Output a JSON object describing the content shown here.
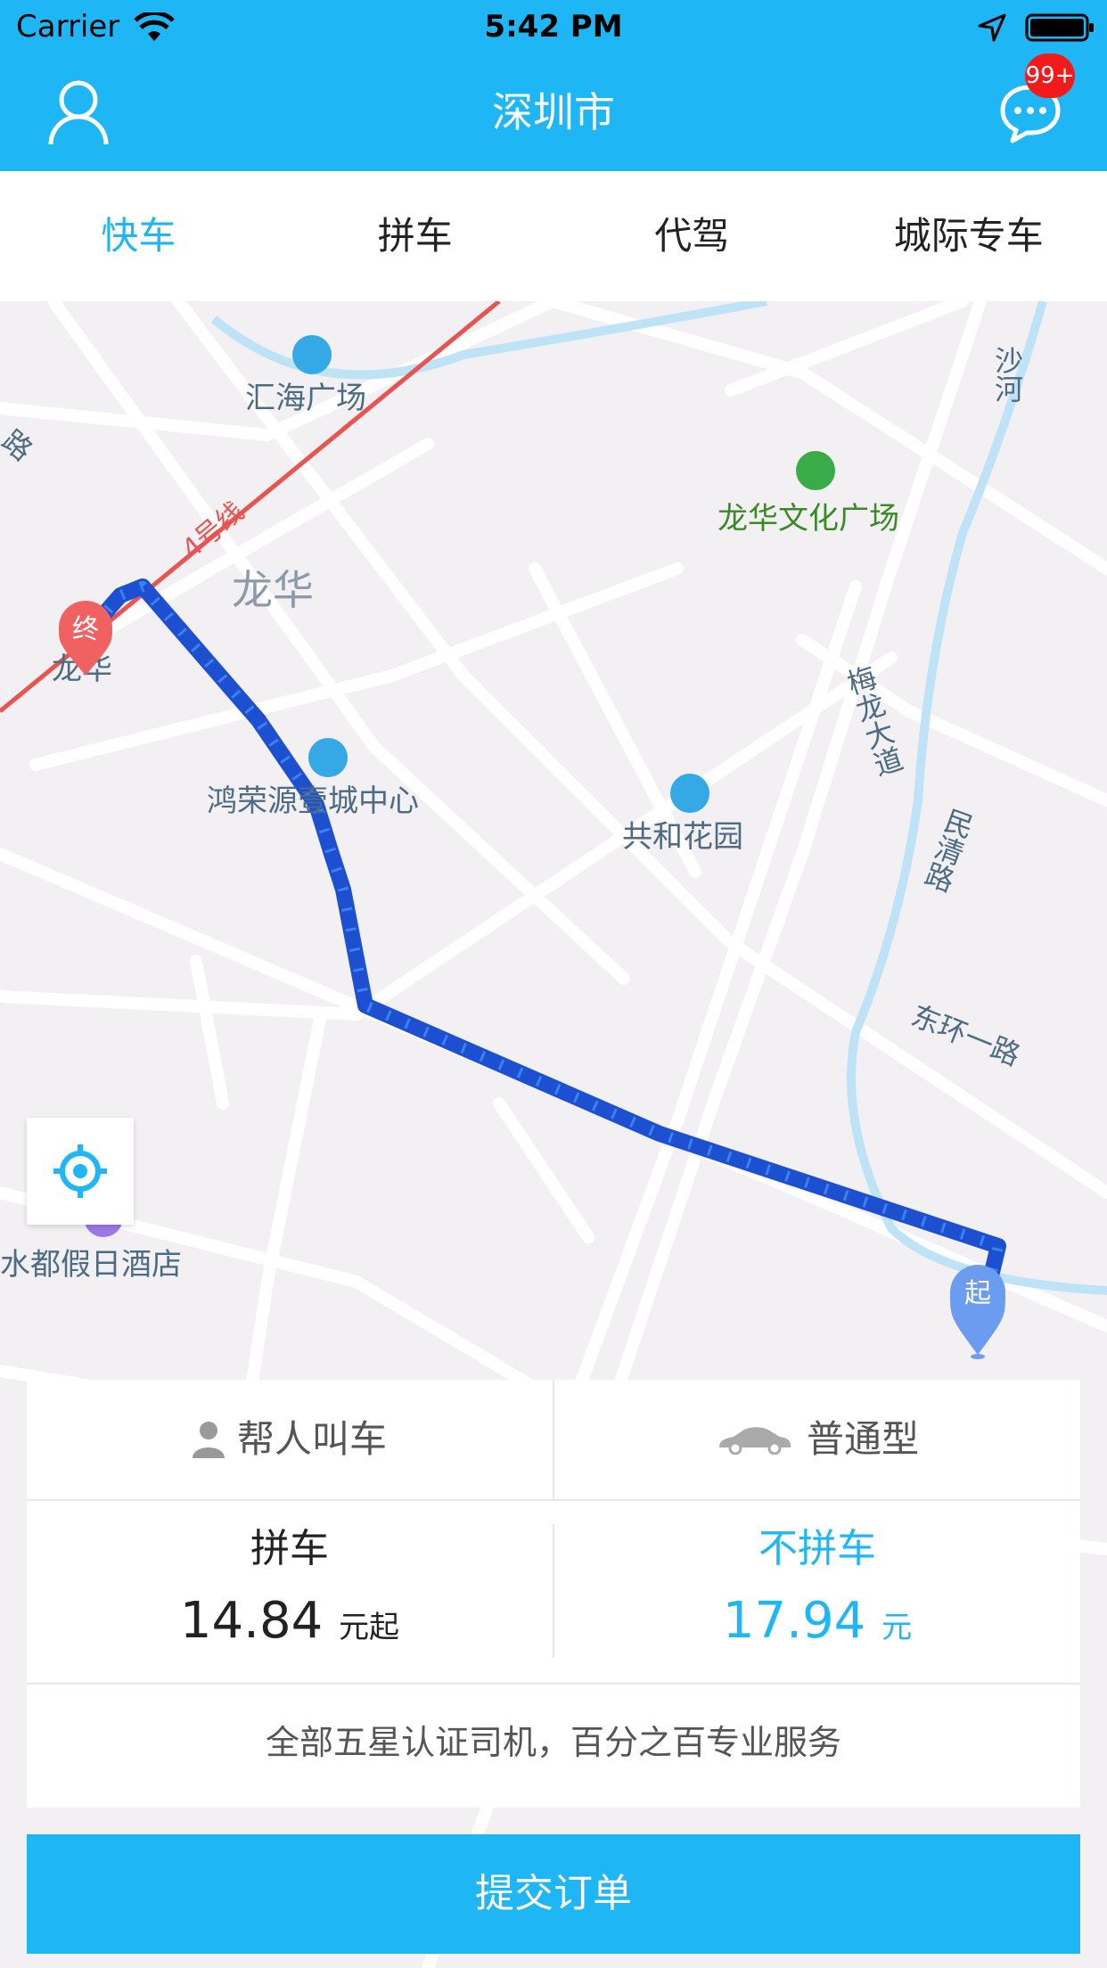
{
  "status_bar": {
    "carrier": "Carrier",
    "time": "5:42 PM"
  },
  "nav": {
    "title": "深圳市",
    "badge": "99+"
  },
  "tabs": [
    {
      "label": "快车",
      "active": true
    },
    {
      "label": "拼车",
      "active": false
    },
    {
      "label": "代驾",
      "active": false
    },
    {
      "label": "城际专车",
      "active": false
    }
  ],
  "map": {
    "labels": {
      "huihai": "汇海广场",
      "line4": "4号线",
      "longhua_area": "龙华",
      "longhua_culture": "龙华文化广场",
      "shahe": "沙河",
      "end_name": "龙华",
      "hongrong": "鸿荣源壹城中心",
      "gonghe": "共和花园",
      "meilong": "梅龙大道",
      "minqing": "民清路",
      "donghuan": "东环一路",
      "shuidu": "水都假日酒店",
      "road_lu": "路"
    },
    "markers": {
      "end": "终",
      "start": "起"
    }
  },
  "card": {
    "help_call": "帮人叫车",
    "car_type": "普通型",
    "carpool": {
      "name": "拼车",
      "price": "14.84",
      "unit": "元起"
    },
    "no_carpool": {
      "name": "不拼车",
      "price": "17.94",
      "unit": "元"
    },
    "tagline": "全部五星认证司机，百分之百专业服务"
  },
  "submit_label": "提交订单",
  "colors": {
    "brand": "#1fb6f5",
    "route": "#2f74e6",
    "badge": "#f51a1a"
  }
}
